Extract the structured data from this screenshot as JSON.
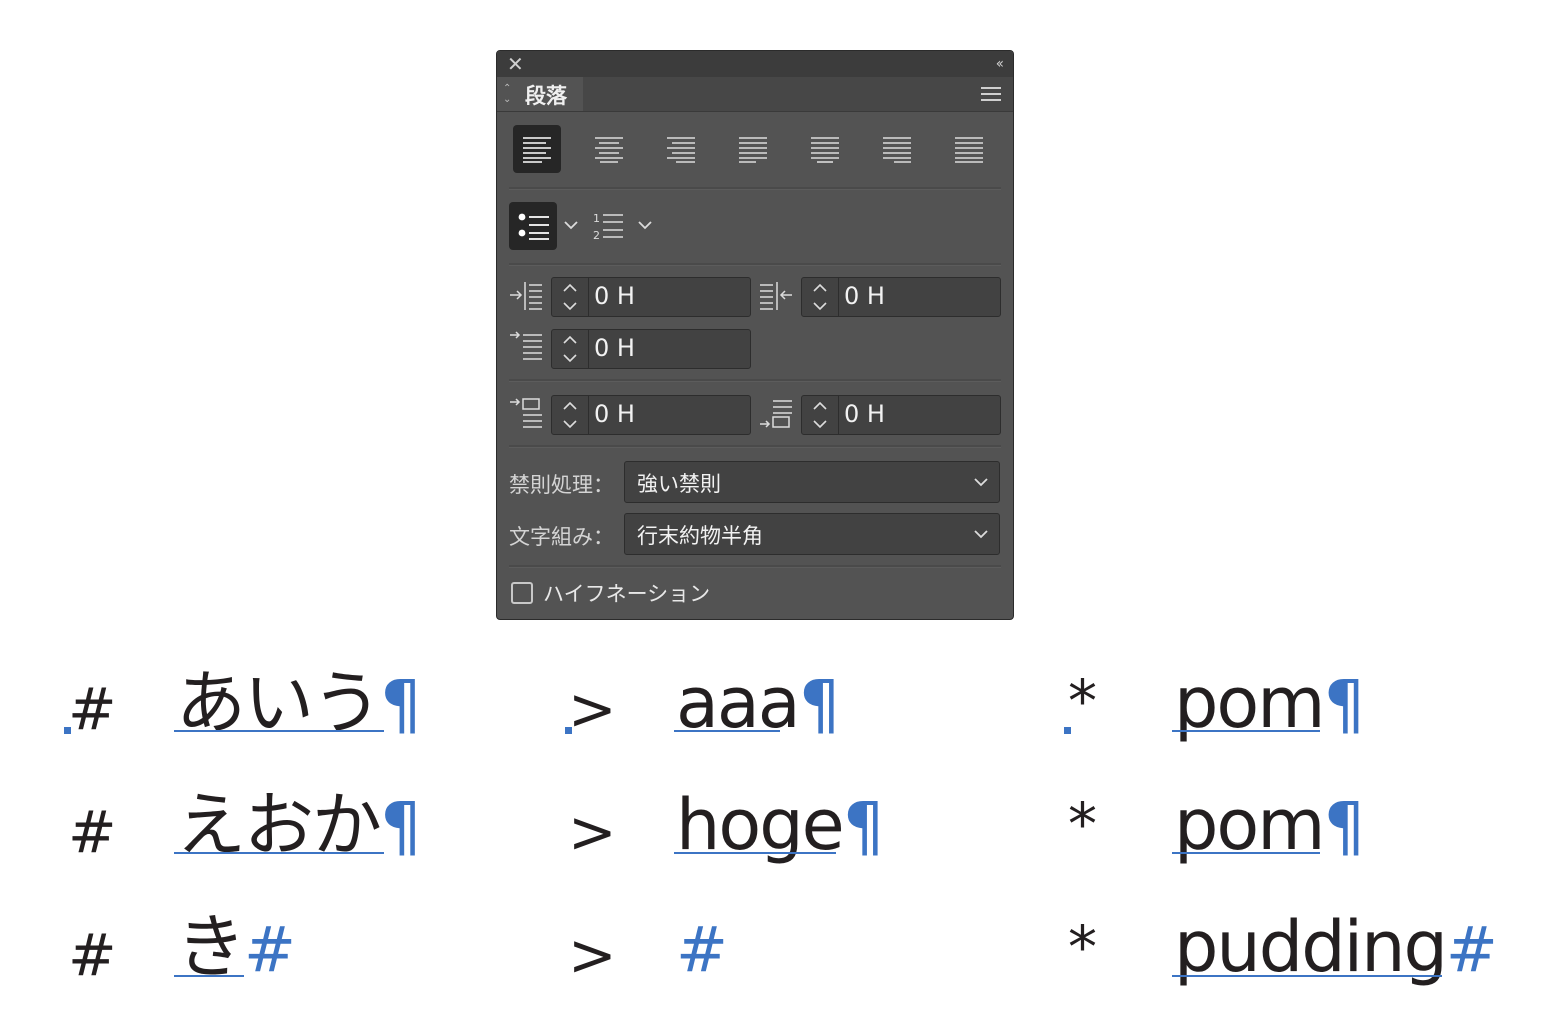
{
  "panel": {
    "tab_title": "段落",
    "indent_left": "0 H",
    "indent_right": "0 H",
    "indent_first": "0 H",
    "space_before": "0 H",
    "space_after": "0 H",
    "kinsoku_label": "禁則処理：",
    "kinsoku_value": "強い禁則",
    "mojikumi_label": "文字組み：",
    "mojikumi_value": "行末約物半角",
    "hyphenation_label": "ハイフネーション",
    "hyphenation_checked": false,
    "active_alignment": "align-left",
    "accent_color": "#3c74c4"
  },
  "document": {
    "col1": {
      "marker": "#",
      "lines": [
        {
          "text": "あいう",
          "end": "¶"
        },
        {
          "text": "えおか",
          "end": "¶"
        },
        {
          "text": "き",
          "end": "#"
        }
      ]
    },
    "col2": {
      "marker": ">",
      "lines": [
        {
          "text": "aaa",
          "end": "¶"
        },
        {
          "text": "hoge",
          "end": "¶"
        },
        {
          "text": "",
          "end": "#"
        }
      ]
    },
    "col3": {
      "marker": "*",
      "lines": [
        {
          "text": "pom",
          "end": "¶"
        },
        {
          "text": "pom",
          "end": "¶"
        },
        {
          "text": "pudding",
          "end": "#"
        }
      ]
    }
  }
}
